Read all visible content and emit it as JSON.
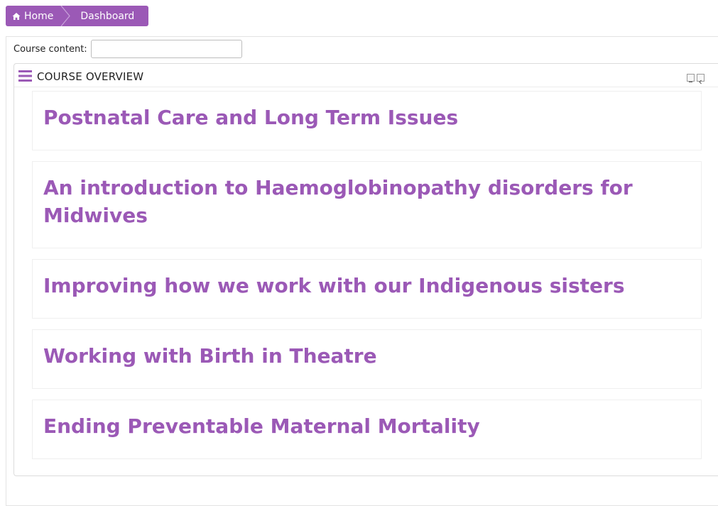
{
  "breadcrumb": {
    "home_label": "Home",
    "dashboard_label": "Dashboard"
  },
  "filter": {
    "label": "Course content:",
    "value": "",
    "placeholder": ""
  },
  "block": {
    "title": "COURSE OVERVIEW"
  },
  "courses": [
    "Postnatal Care and Long Term Issues",
    "An introduction to Haemoglobinopathy disorders for Midwives",
    "Improving how we work with our Indigenous sisters",
    "Working with Birth in Theatre",
    "Ending Preventable Maternal Mortality"
  ],
  "colors": {
    "accent": "#9b59b6",
    "border": "#e3e3e3"
  },
  "icons": [
    "home-icon",
    "menu-icon",
    "collapse-icon",
    "dock-icon"
  ]
}
